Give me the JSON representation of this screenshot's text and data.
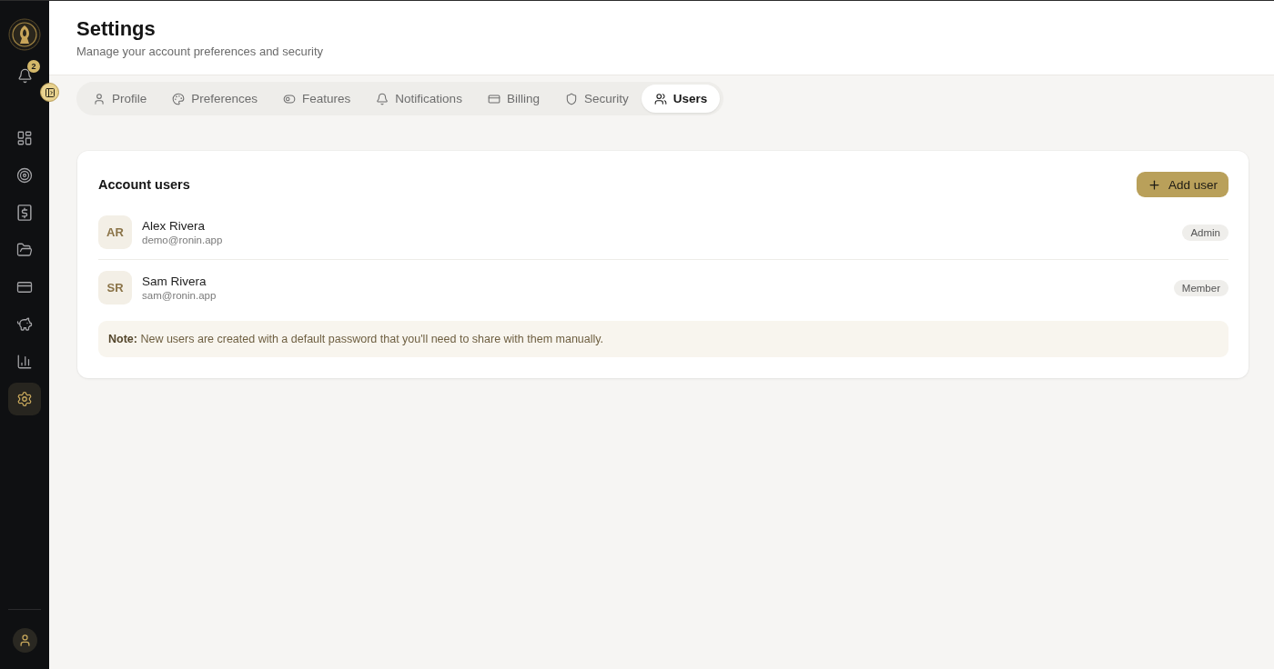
{
  "sidebar": {
    "notification_count": "2",
    "nav_items": [
      {
        "kind": "grid",
        "selected": false
      },
      {
        "kind": "target",
        "selected": false
      },
      {
        "kind": "dollar",
        "selected": false
      },
      {
        "kind": "folder",
        "selected": false
      },
      {
        "kind": "card",
        "selected": false
      },
      {
        "kind": "piggy",
        "selected": false
      },
      {
        "kind": "chart",
        "selected": false
      },
      {
        "kind": "gear",
        "selected": true
      }
    ]
  },
  "header": {
    "title": "Settings",
    "subtitle": "Manage your account preferences and security"
  },
  "tabs": [
    {
      "label": "Profile",
      "kind": "person",
      "selected": false
    },
    {
      "label": "Preferences",
      "kind": "palette",
      "selected": false
    },
    {
      "label": "Features",
      "kind": "toggle",
      "selected": false
    },
    {
      "label": "Notifications",
      "kind": "bell",
      "selected": false
    },
    {
      "label": "Billing",
      "kind": "card",
      "selected": false
    },
    {
      "label": "Security",
      "kind": "shield",
      "selected": false
    },
    {
      "label": "Users",
      "kind": "people",
      "selected": true
    }
  ],
  "account_users": {
    "title": "Account users",
    "add_button": "Add user",
    "users": [
      {
        "initials": "AR",
        "name": "Alex Rivera",
        "email": "demo@ronin.app",
        "role": "Admin"
      },
      {
        "initials": "SR",
        "name": "Sam Rivera",
        "email": "sam@ronin.app",
        "role": "Member"
      }
    ],
    "note": "**Note:** New users are created with a default password that you'll need to share with them manually."
  }
}
